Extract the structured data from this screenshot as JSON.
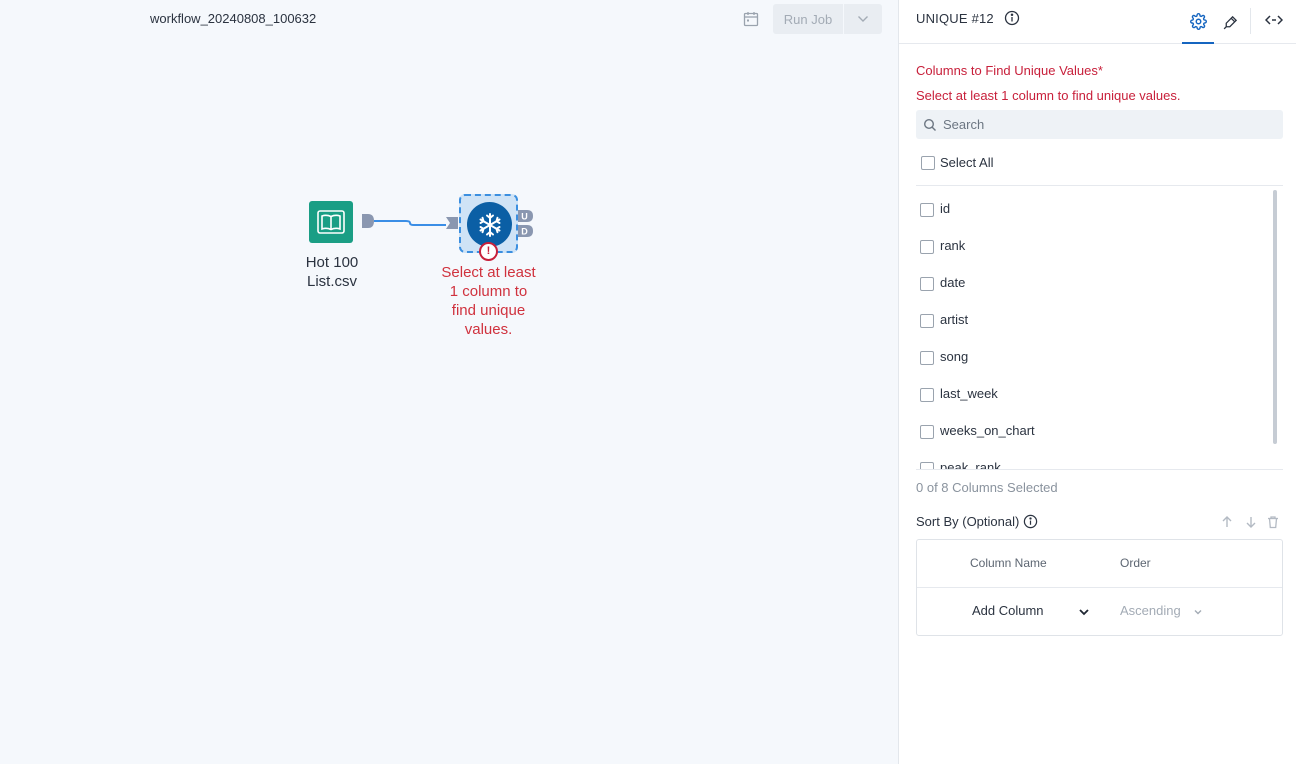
{
  "canvas": {
    "workflow_name": "workflow_20240808_100632",
    "run_job_label": "Run Job",
    "input_node_label": "Hot 100 List.csv",
    "unique_node_error": "Select at least 1 column to find unique values.",
    "anchor_u": "U",
    "anchor_d": "D"
  },
  "panel": {
    "title": "UNIQUE #12",
    "section_title": "Columns to Find Unique Values*",
    "section_error": "Select at least 1 column to find unique values.",
    "search_placeholder": "Search",
    "search_value": "",
    "select_all_label": "Select All",
    "columns": [
      {
        "name": "id",
        "checked": false
      },
      {
        "name": "rank",
        "checked": false
      },
      {
        "name": "date",
        "checked": false
      },
      {
        "name": "artist",
        "checked": false
      },
      {
        "name": "song",
        "checked": false
      },
      {
        "name": "last_week",
        "checked": false
      },
      {
        "name": "weeks_on_chart",
        "checked": false
      },
      {
        "name": "peak_rank",
        "checked": false
      }
    ],
    "selected_count": "0 of 8 Columns Selected",
    "sort_title": "Sort By (Optional)",
    "sort_table": {
      "header_column_name": "Column Name",
      "header_order": "Order",
      "add_column_label": "Add Column",
      "order_value": "Ascending"
    }
  },
  "colors": {
    "accent": "#1565c0",
    "error": "#c8203b",
    "input_node": "#1a9e85",
    "unique_node": "#0b5fa5"
  }
}
